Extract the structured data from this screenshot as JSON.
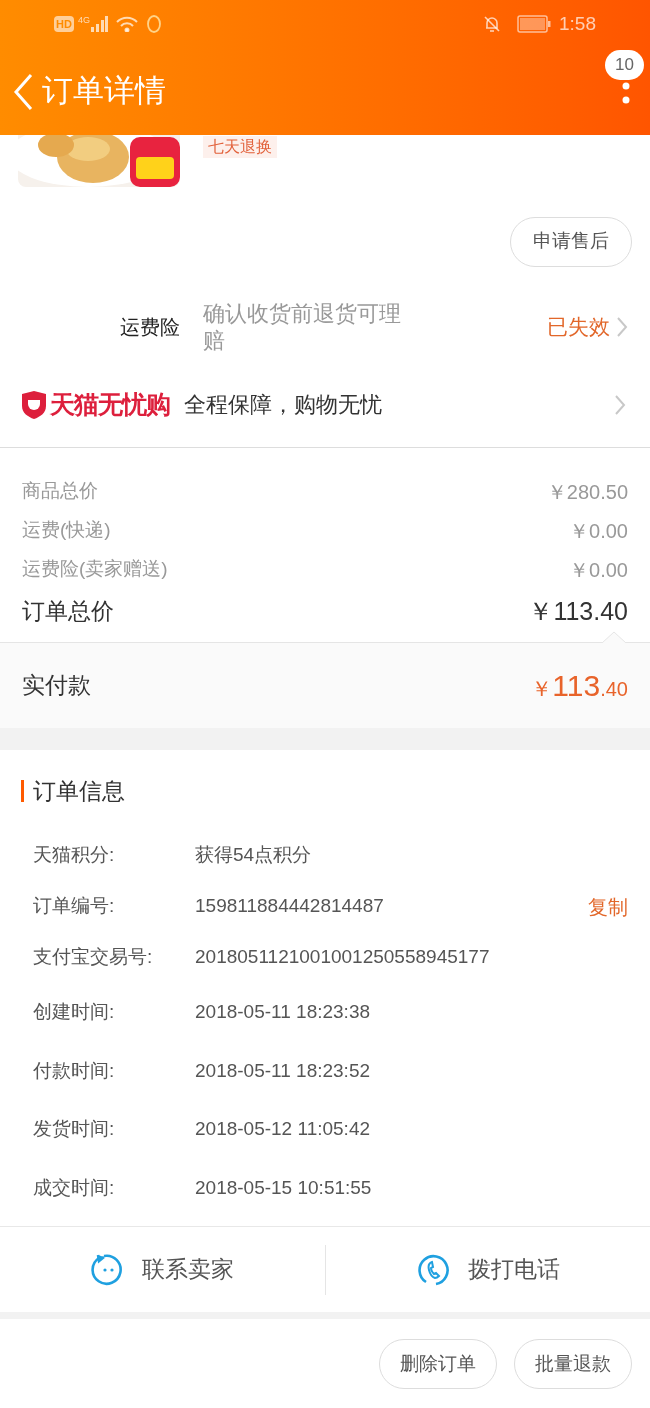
{
  "status_bar": {
    "hd": "HD",
    "network": "4G",
    "time": "1:58"
  },
  "header": {
    "title": "订单详情",
    "badge": "10"
  },
  "product": {
    "tag": "七天退换",
    "after_sale_button": "申请售后"
  },
  "insurance": {
    "label": "运费险",
    "description": "确认收货前退货可理赔",
    "status": "已失效"
  },
  "guarantee": {
    "brand": "天猫无忧购",
    "text": "全程保障，购物无忧"
  },
  "price_rows": [
    {
      "label": "商品总价",
      "value": "￥280.50",
      "kind": "minor"
    },
    {
      "label": "运费(快递)",
      "value": "￥0.00",
      "kind": "minor"
    },
    {
      "label": "运费险(卖家赠送)",
      "value": "￥0.00",
      "kind": "minor"
    },
    {
      "label": "订单总价",
      "value": "￥113.40",
      "kind": "total"
    }
  ],
  "paid": {
    "label": "实付款",
    "currency": "￥",
    "integer": "113",
    "decimal": ".40"
  },
  "order_info": {
    "title": "订单信息",
    "rows": [
      {
        "label": "天猫积分:",
        "value": "获得54点积分"
      },
      {
        "label": "订单编号:",
        "value": "159811884442814487",
        "action": "复制"
      },
      {
        "label": "支付宝交易号:",
        "value": "2018051121001001250558945177"
      },
      {
        "label": "创建时间:",
        "value": "2018-05-11 18:23:38"
      },
      {
        "label": "付款时间:",
        "value": "2018-05-11 18:23:52"
      },
      {
        "label": "发货时间:",
        "value": "2018-05-12 11:05:42"
      },
      {
        "label": "成交时间:",
        "value": "2018-05-15 10:51:55"
      }
    ]
  },
  "contact": [
    {
      "label": "联系卖家",
      "kind": "chat"
    },
    {
      "label": "拨打电话",
      "kind": "phone"
    }
  ],
  "actions": [
    "删除订单",
    "批量退款"
  ]
}
